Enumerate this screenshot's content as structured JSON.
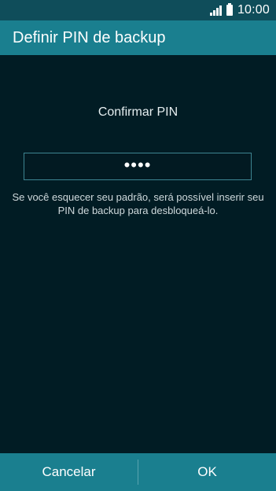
{
  "status_bar": {
    "time": "10:00",
    "signal_icon": "signal-icon",
    "battery_icon": "battery-icon"
  },
  "header": {
    "title": "Definir PIN de backup"
  },
  "main": {
    "prompt": "Confirmar PIN",
    "pin_value": "••••",
    "hint_line1": "Se você esquecer seu padrão, será possível inserir seu",
    "hint_line2": "PIN de backup para desbloqueá-lo."
  },
  "footer": {
    "cancel_label": "Cancelar",
    "ok_label": "OK"
  },
  "colors": {
    "background": "#011c24",
    "accent": "#1a7f8f",
    "statusbar": "#0f4d5a",
    "field_border": "#3e8592"
  }
}
